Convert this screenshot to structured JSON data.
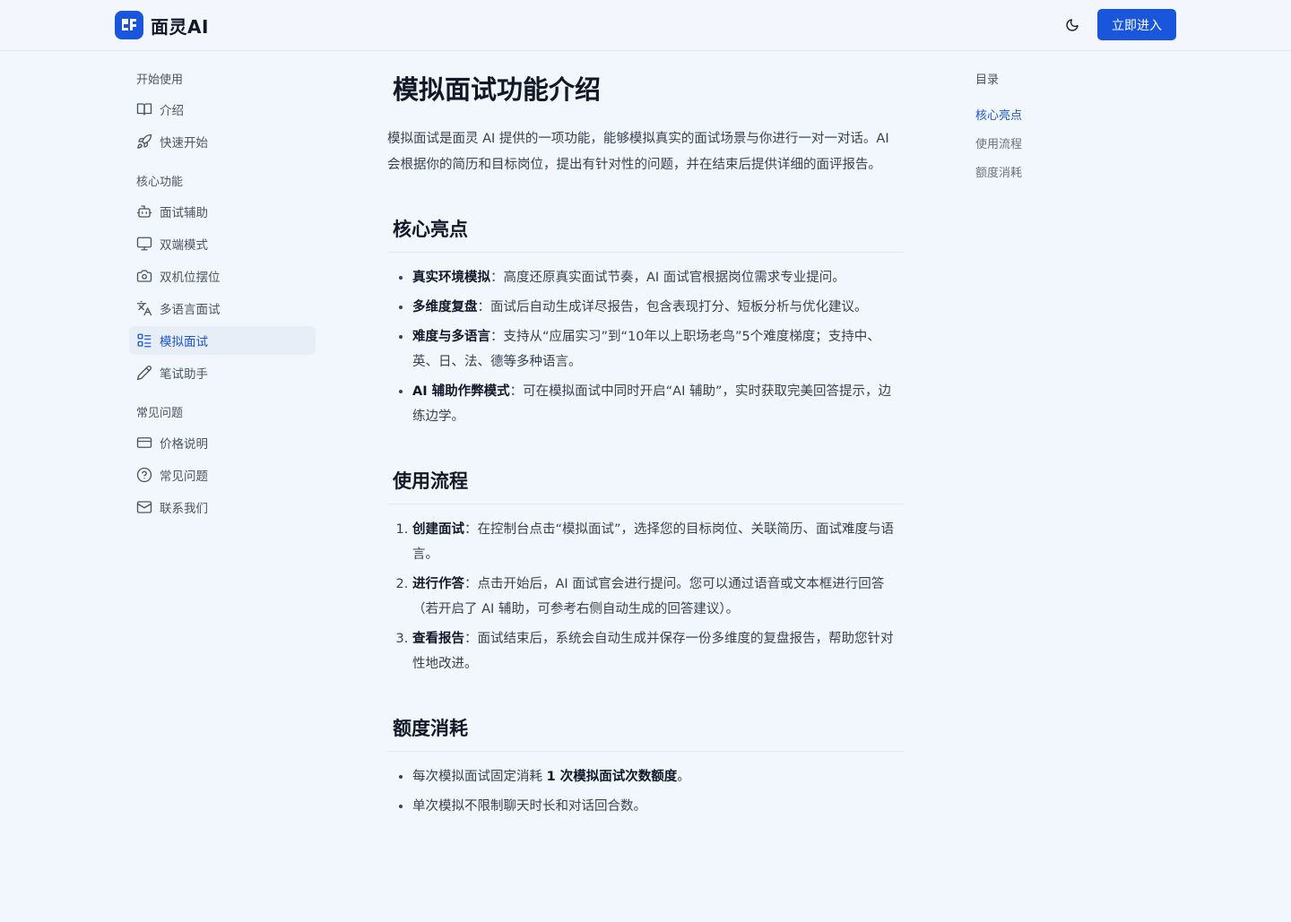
{
  "header": {
    "logo_text": "面灵AI",
    "enter_label": "立即进入"
  },
  "sidebar": {
    "groups": [
      {
        "title": "开始使用",
        "items": [
          "介绍",
          "快速开始"
        ]
      },
      {
        "title": "核心功能",
        "items": [
          "面试辅助",
          "双端模式",
          "双机位摆位",
          "多语言面试",
          "模拟面试",
          "笔试助手"
        ]
      },
      {
        "title": "常见问题",
        "items": [
          "价格说明",
          "常见问题",
          "联系我们"
        ]
      }
    ]
  },
  "main": {
    "title": "模拟面试功能介绍",
    "intro": "模拟面试是面灵 AI 提供的一项功能，能够模拟真实的面试场景与你进行一对一对话。AI 会根据你的简历和目标岗位，提出有针对性的问题，并在结束后提供详细的面评报告。",
    "highlights": {
      "heading": "核心亮点",
      "items": [
        {
          "term": "真实环境模拟",
          "desc": "：高度还原真实面试节奏，AI 面试官根据岗位需求专业提问。"
        },
        {
          "term": "多维度复盘",
          "desc": "：面试后自动生成详尽报告，包含表现打分、短板分析与优化建议。"
        },
        {
          "term": "难度与多语言",
          "desc": "：支持从“应届实习”到“10年以上职场老鸟”5个难度梯度；支持中、英、日、法、德等多种语言。"
        },
        {
          "term": "AI 辅助作弊模式",
          "desc": "：可在模拟面试中同时开启“AI 辅助”，实时获取完美回答提示，边练边学。"
        }
      ]
    },
    "flow": {
      "heading": "使用流程",
      "items": [
        {
          "term": "创建面试",
          "desc": "：在控制台点击“模拟面试”，选择您的目标岗位、关联简历、面试难度与语言。"
        },
        {
          "term": "进行作答",
          "desc": "：点击开始后，AI 面试官会进行提问。您可以通过语音或文本框进行回答（若开启了 AI 辅助，可参考右侧自动生成的回答建议）。"
        },
        {
          "term": "查看报告",
          "desc": "：面试结束后，系统会自动生成并保存一份多维度的复盘报告，帮助您针对性地改进。"
        }
      ]
    },
    "quota": {
      "heading": "额度消耗",
      "item1_pre": "每次模拟面试固定消耗 ",
      "item1_bold": "1 次模拟面试次数额度",
      "item1_post": "。",
      "item2": "单次模拟不限制聊天时长和对话回合数。"
    }
  },
  "toc": {
    "title": "目录",
    "items": [
      "核心亮点",
      "使用流程",
      "额度消耗"
    ]
  },
  "colors": {
    "accent": "#1a56db",
    "background": "#f2f7fe"
  }
}
